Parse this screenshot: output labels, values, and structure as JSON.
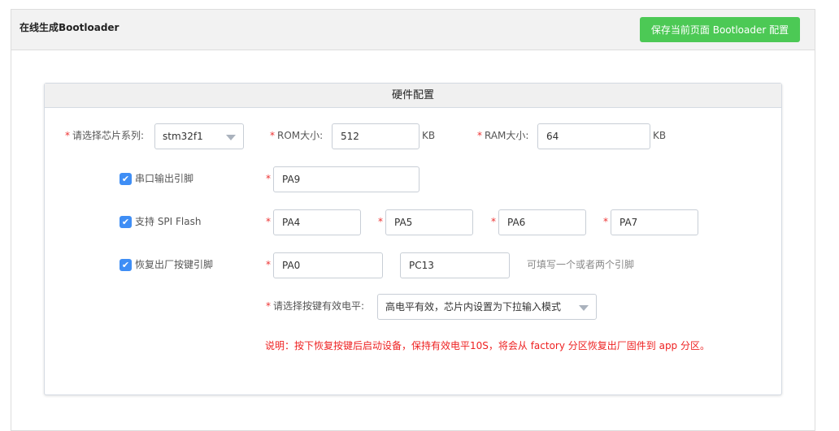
{
  "page": {
    "title": "在线生成Bootloader",
    "save_button": "保存当前页面 Bootloader 配置"
  },
  "card": {
    "title": "硬件配置",
    "chip": {
      "label": "请选择芯片系列:",
      "value": "stm32f1"
    },
    "rom": {
      "label": "ROM大小:",
      "value": "512",
      "unit": "KB"
    },
    "ram": {
      "label": "RAM大小:",
      "value": "64",
      "unit": "KB"
    },
    "uart": {
      "label": "串口输出引脚",
      "checked": true,
      "pin": "PA9"
    },
    "spi": {
      "label": "支持 SPI Flash",
      "checked": true,
      "pins": [
        "PA4",
        "PA5",
        "PA6",
        "PA7"
      ]
    },
    "factory": {
      "label": "恢复出厂按键引脚",
      "checked": true,
      "pins": [
        "PA0",
        "PC13"
      ],
      "hint": "可填写一个或者两个引脚"
    },
    "level": {
      "label": "请选择按键有效电平:",
      "value": "高电平有效，芯片内设置为下拉输入模式"
    },
    "note": "说明：按下恢复按键后启动设备，保持有效电平10S，将会从 factory 分区恢复出厂固件到 app 分区。",
    "required_mark": "*",
    "check_mark": "✔"
  }
}
